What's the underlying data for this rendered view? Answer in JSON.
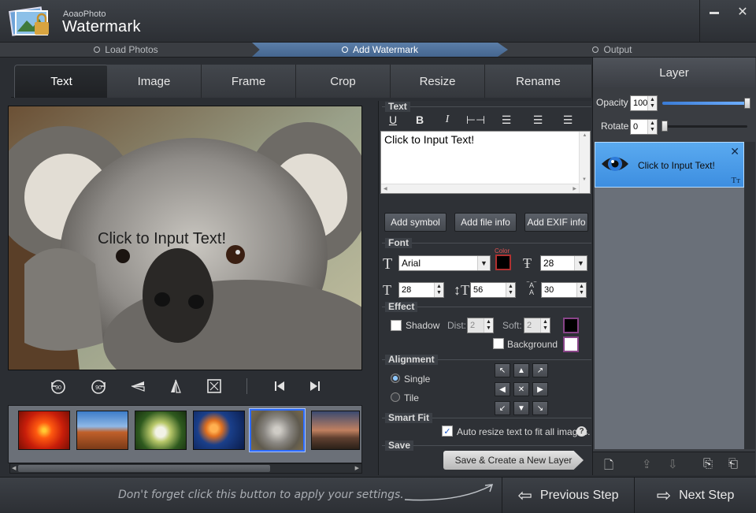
{
  "app": {
    "subtitle": "AoaoPhoto",
    "title": "Watermark"
  },
  "window": {
    "minimize": "▬",
    "close": "✕"
  },
  "steps": [
    {
      "label": "Load Photos"
    },
    {
      "label": "Add Watermark",
      "active": true
    },
    {
      "label": "Output"
    }
  ],
  "tabs": [
    "Text",
    "Image",
    "Frame",
    "Crop",
    "Resize",
    "Rename"
  ],
  "active_tab": "Text",
  "preview": {
    "watermark_text": "Click to Input Text!"
  },
  "text_section": {
    "label": "Text",
    "input_value": "Click to Input Text!",
    "add_symbol": "Add symbol",
    "add_file_info": "Add file info",
    "add_exif_info": "Add EXIF info"
  },
  "font_section": {
    "label": "Font",
    "family": "Arial",
    "color_label": "Color",
    "size": "28",
    "width": "28",
    "line_spacing": "56",
    "char_spacing": "30"
  },
  "effect_section": {
    "label": "Effect",
    "shadow": "Shadow",
    "dist_label": "Dist:",
    "dist": "2",
    "soft_label": "Soft:",
    "soft": "2",
    "background": "Background",
    "shadow_color": "#000000",
    "background_color": "#ffffff"
  },
  "alignment_section": {
    "label": "Alignment",
    "single": "Single",
    "tile": "Tile",
    "mode": "Single"
  },
  "smartfit_section": {
    "label": "Smart Fit",
    "auto_resize": "Auto resize text to fit all images.",
    "auto_resize_checked": true,
    "help": "?"
  },
  "save_section": {
    "label": "Save",
    "button": "Save & Create a New Layer"
  },
  "layer_panel": {
    "title": "Layer",
    "opacity_label": "Opacity",
    "opacity": "100",
    "rotate_label": "Rotate",
    "rotate": "0",
    "item_label": "Click to Input Text!",
    "type_glyph": "Tт"
  },
  "bottom": {
    "hint": "Don't forget click this button to apply your settings.",
    "previous": "Previous Step",
    "next": "Next Step"
  },
  "colors": {
    "accent": "#4a8fe0",
    "step_active": "#5377a0"
  }
}
